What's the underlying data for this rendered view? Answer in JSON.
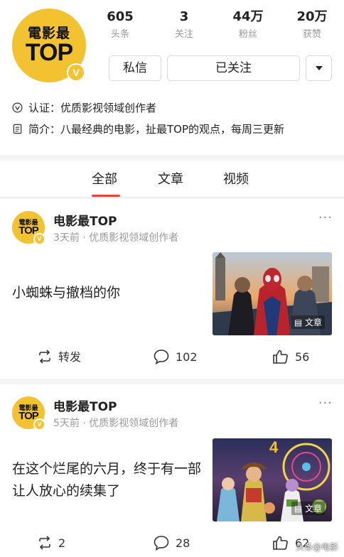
{
  "profile": {
    "avatar": {
      "cn": "電影最",
      "top": "TOP",
      "badge": "V"
    },
    "stats": [
      {
        "num": "605",
        "label": "头条"
      },
      {
        "num": "3",
        "label": "关注"
      },
      {
        "num": "44万",
        "label": "粉丝"
      },
      {
        "num": "20万",
        "label": "获赞"
      }
    ],
    "message_label": "私信",
    "follow_label": "已关注",
    "verification": "认证：优质影视领域创作者",
    "intro": "简介：八最经典的电影，扯最TOP的观点，每周三更新"
  },
  "tabs": [
    "全部",
    "文章",
    "视频"
  ],
  "active_tab": "全部",
  "posts": [
    {
      "author": "电影最TOP",
      "meta": "3天前 · 优质影视领域创作者",
      "title": "小蜘蛛与撤档的你",
      "thumb_label": "文章",
      "share": "转发",
      "comments": "102",
      "likes": "56"
    },
    {
      "author": "电影最TOP",
      "meta": "5天前 · 优质影视领域创作者",
      "title": "在这个烂尾的六月，终于有一部让人放心的续集了",
      "thumb_label": "文章",
      "share": "2",
      "comments": "28",
      "likes": "62"
    }
  ],
  "watermark": "头条@电影"
}
